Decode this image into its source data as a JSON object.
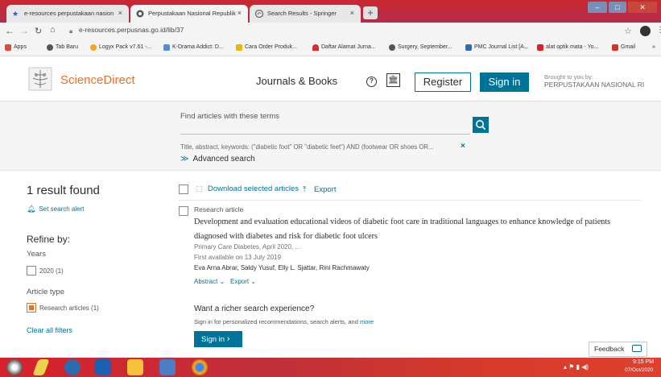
{
  "browser": {
    "tabs": [
      {
        "label": "e-resources perpustakaan nasion",
        "close": "×",
        "icon": "star-icon"
      },
      {
        "label": "Perpustakaan Nasional Republik",
        "close": "×",
        "icon": "chrome-icon"
      },
      {
        "label": "Search Results - Springer",
        "close": "×",
        "icon": "springer-icon"
      }
    ],
    "new_tab": "+",
    "url": "e-resources.perpusnas.go.id/lib/37",
    "bookmarks": [
      {
        "label": "Apps",
        "color": "#e0463a"
      },
      {
        "label": "Tab Baru",
        "color": "#555555"
      },
      {
        "label": "Logyx Pack v7.61 -...",
        "color": "#f5a623"
      },
      {
        "label": "K-Drama Addict: D...",
        "color": "#4a90d9"
      },
      {
        "label": "Cara Order Produk...",
        "color": "#e8b800"
      },
      {
        "label": "Daftar Alamat Jurna...",
        "color": "#d32f2f"
      },
      {
        "label": "Surgery, September...",
        "color": "#555555"
      },
      {
        "label": "PMC Journal List [A...",
        "color": "#2e6db4"
      },
      {
        "label": "alat optik mata - Yo...",
        "color": "#e02020"
      },
      {
        "label": "Gmail",
        "color": "#d93025"
      }
    ],
    "overflow": "»"
  },
  "header": {
    "brand": "ScienceDirect",
    "journals_books": "Journals & Books",
    "help": "?",
    "register": "Register",
    "signin": "Sign in",
    "brought_line1": "Brought to you by:",
    "brought_line2": "PERPUSTAKAAN NASIONAL RI"
  },
  "search": {
    "find_label": "Find articles with these terms",
    "terms": "Title, abstract, keywords: (\"diabetic foot\" OR \"diabetic feet\") AND (footwear OR shoes OR...",
    "clear": "×",
    "advanced": "Advanced search"
  },
  "sidebar": {
    "result_count": "1 result found",
    "save_alert": "Set search alert",
    "refine_by": "Refine by:",
    "years_label": "Years",
    "year_item": "2020 (1)",
    "article_type_label": "Article type",
    "article_type_item": "Research articles (1)",
    "clear_all": "Clear all filters"
  },
  "results": {
    "download_selected": "Download selected articles",
    "export": "Export",
    "items": [
      {
        "type": "Research article",
        "title": "Development and evaluation educational videos of diabetic foot care in traditional languages to enhance knowledge of patients diagnosed with diabetes and risk for diabetic foot ulcers",
        "journal": "Primary Care Diabetes, April 2020, ...",
        "available": "First available on 13 July 2019",
        "authors": "Eva Arna Abrar, Saldy Yusuf, Elly L. Sjattar, Rini Rachmawaty",
        "abstract_link": "Abstract",
        "export_link": "Export"
      }
    ],
    "richer_title": "Want a richer search experience?",
    "richer_text": "Sign in for personalized recommendations, search alerts, and",
    "richer_more": "more",
    "signin_button": "Sign in",
    "feedback": "Feedback"
  },
  "taskbar": {
    "time": "9:15 PM",
    "date": "07/Oct/2020"
  }
}
